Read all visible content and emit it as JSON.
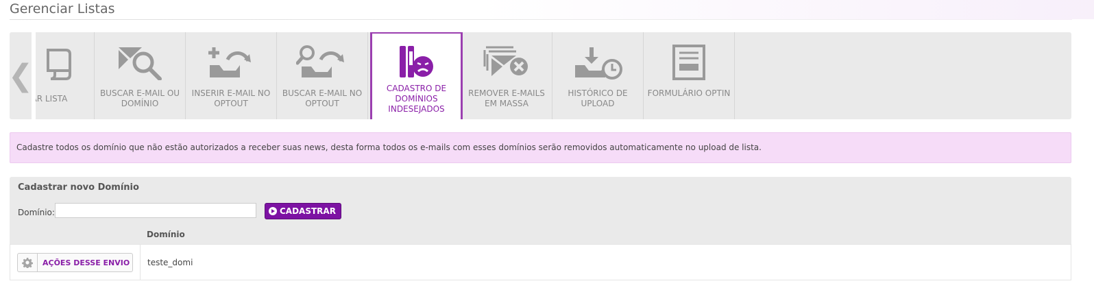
{
  "page": {
    "title": "Gerenciar Listas"
  },
  "colors": {
    "accent": "#8a1fa8",
    "button_bg": "#7d12a3",
    "info_bg": "#f6dcf8",
    "tab_icon": "#9a9a9a"
  },
  "tabs": [
    {
      "label": "IAR LISTA",
      "icon": "scroll-icon",
      "active": false
    },
    {
      "label": "BUSCAR E-MAIL OU DOMÍNIO",
      "icon": "envelope-search-icon",
      "active": false
    },
    {
      "label": "INSERIR E-MAIL NO OPTOUT",
      "icon": "inbox-add-icon",
      "active": false
    },
    {
      "label": "BUSCAR E-MAIL NO OPTOUT",
      "icon": "inbox-search-icon",
      "active": false
    },
    {
      "label": "CADASTRO DE DOMÍNIOS INDESEJADOS",
      "icon": "blocked-domain-icon",
      "active": true
    },
    {
      "label": "REMOVER E-MAILS EM MASSA",
      "icon": "envelopes-remove-icon",
      "active": false
    },
    {
      "label": "HISTÓRICO DE UPLOAD",
      "icon": "upload-history-icon",
      "active": false
    },
    {
      "label": "FORMULÁRIO OPTIN",
      "icon": "form-icon",
      "active": false
    }
  ],
  "nav": {
    "prev_glyph": "❮"
  },
  "info": {
    "text": "Cadastre todos os domínio que não estão autorizados a receber suas news, desta forma todos os e-mails com esses domínios serão removidos automaticamente no upload de lista."
  },
  "form": {
    "title": "Cadastrar novo Domínio",
    "domain_label": "Domínio:",
    "domain_value": "",
    "domain_placeholder": "",
    "submit_label": "CADASTRAR"
  },
  "table": {
    "columns": [
      "",
      "Domínio"
    ],
    "rows": [
      {
        "actions_label": "AÇÕES DESSE ENVIO",
        "domain": "teste_domi"
      }
    ]
  }
}
